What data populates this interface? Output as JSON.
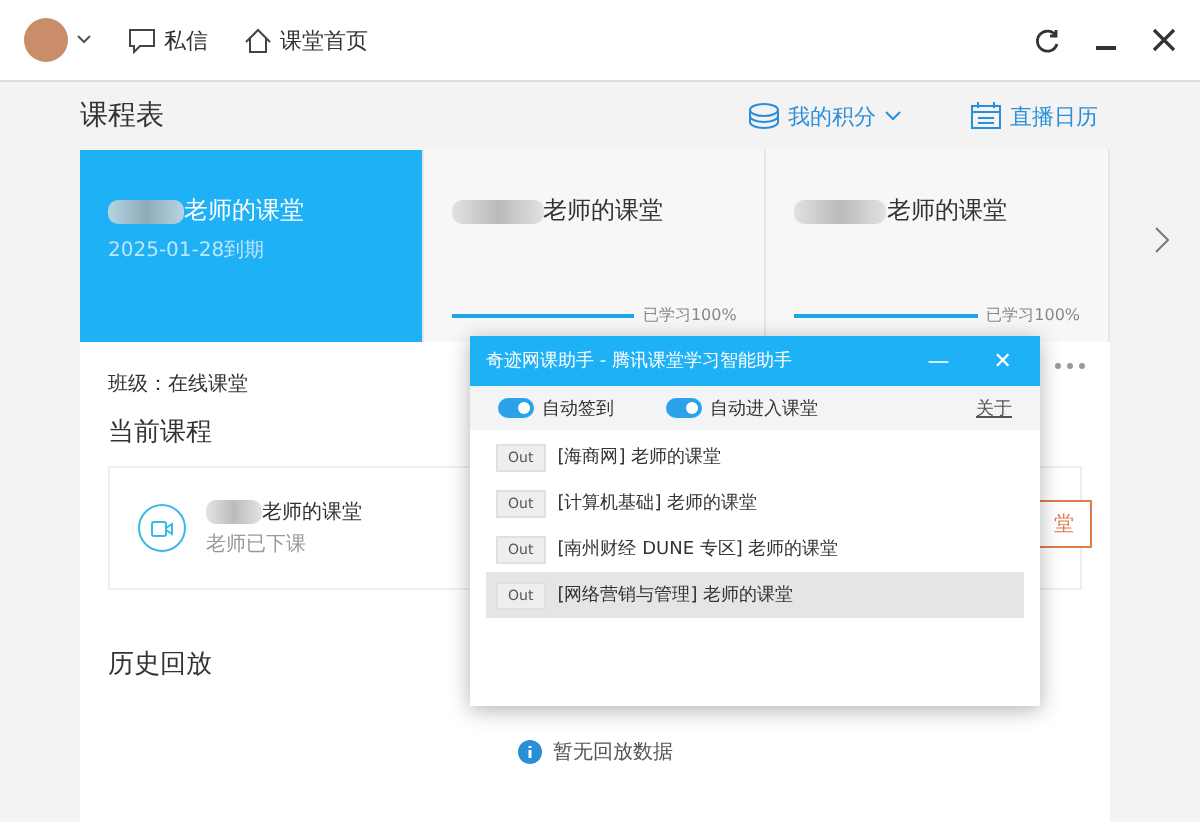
{
  "topbar": {
    "messages": "私信",
    "home": "课堂首页"
  },
  "header": {
    "title": "课程表",
    "points": "我的积分",
    "calendar": "直播日历"
  },
  "courses": [
    {
      "name": "老师的课堂",
      "date": "2025-01-28到期",
      "selected": true
    },
    {
      "name": "老师的课堂",
      "progress": "已学习100%",
      "level": 1,
      "selected": false
    },
    {
      "name": "老师的课堂",
      "progress": "已学习100%",
      "level": 1,
      "selected": false
    }
  ],
  "class_info": "班级：在线课堂",
  "current": {
    "heading": "当前课程",
    "course": "老师的课堂",
    "status": "老师已下课",
    "action": "堂"
  },
  "history": {
    "heading": "历史回放",
    "empty": "暂无回放数据"
  },
  "popup": {
    "title": "奇迹网课助手 - 腾讯课堂学习智能助手",
    "minimize": "—",
    "close": "✕",
    "toggles": [
      {
        "label": "自动签到",
        "on": true
      },
      {
        "label": "自动进入课堂",
        "on": true
      }
    ],
    "about": "关于",
    "rows": [
      {
        "button": "Out",
        "name": "[海商网] 老师的课堂",
        "selected": false
      },
      {
        "button": "Out",
        "name": "[计算机基础] 老师的课堂",
        "selected": false
      },
      {
        "button": "Out",
        "name": "[南州财经 DUNE 专区] 老师的课堂",
        "selected": false
      },
      {
        "button": "Out",
        "name": "[网络营销与管理] 老师的课堂",
        "selected": true
      }
    ]
  }
}
